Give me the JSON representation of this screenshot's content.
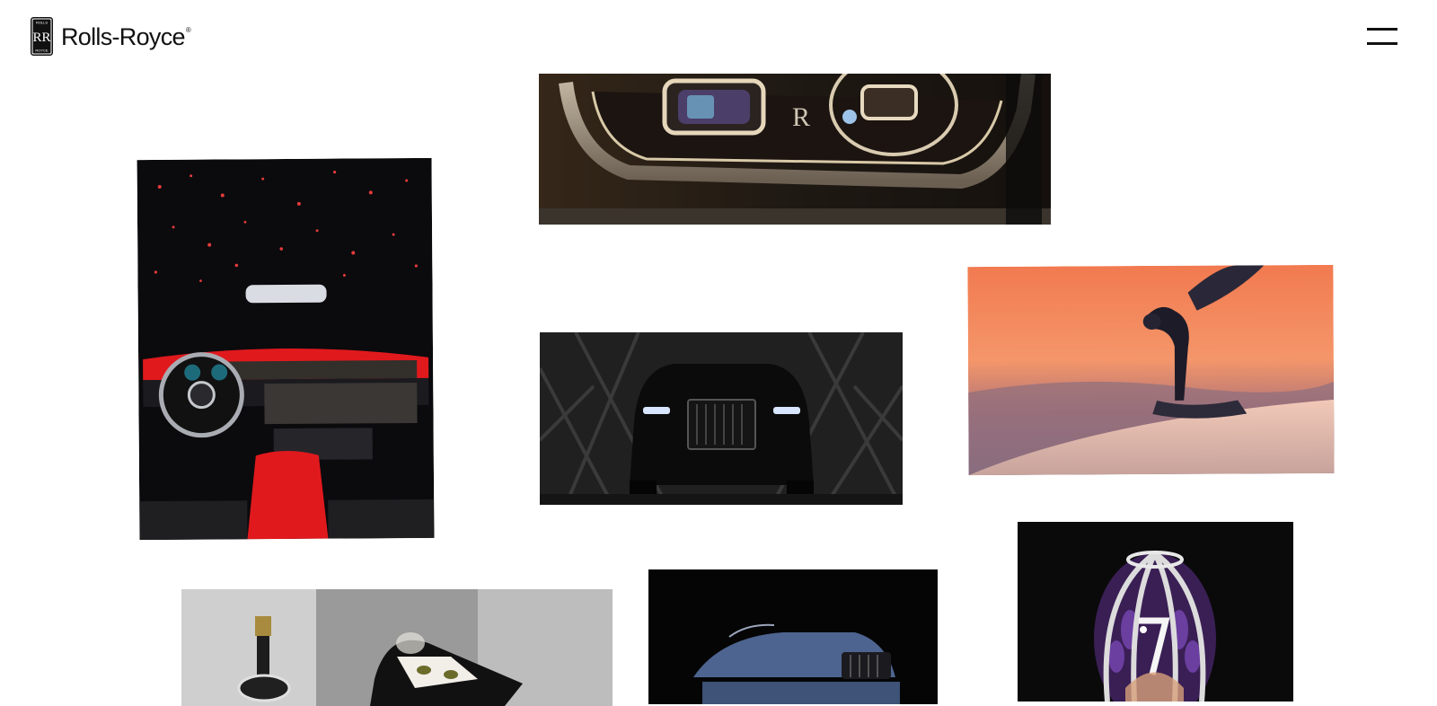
{
  "brand": {
    "name": "Rolls-Royce",
    "registered_mark": "®",
    "badge_top": "ROLLS",
    "badge_monogram": "RR",
    "badge_bottom": "ROYCE"
  },
  "header": {
    "menu_icon": "hamburger-icon"
  },
  "gallery": {
    "tiles": [
      {
        "id": "headlight",
        "subject": "headlight-closeup-image"
      },
      {
        "id": "interior",
        "subject": "starlight-interior-image"
      },
      {
        "id": "cullinan",
        "subject": "black-badge-suv-image"
      },
      {
        "id": "ecstasy",
        "subject": "spirit-of-ecstasy-image"
      },
      {
        "id": "picnic",
        "subject": "champagne-hamper-image"
      },
      {
        "id": "droptail",
        "subject": "convertible-image"
      },
      {
        "id": "egg",
        "subject": "jewelled-egg-image"
      }
    ]
  },
  "colors": {
    "background": "#ffffff",
    "text": "#111111",
    "interior_red": "#e0191d",
    "sunset_orange": "#f08a55"
  }
}
